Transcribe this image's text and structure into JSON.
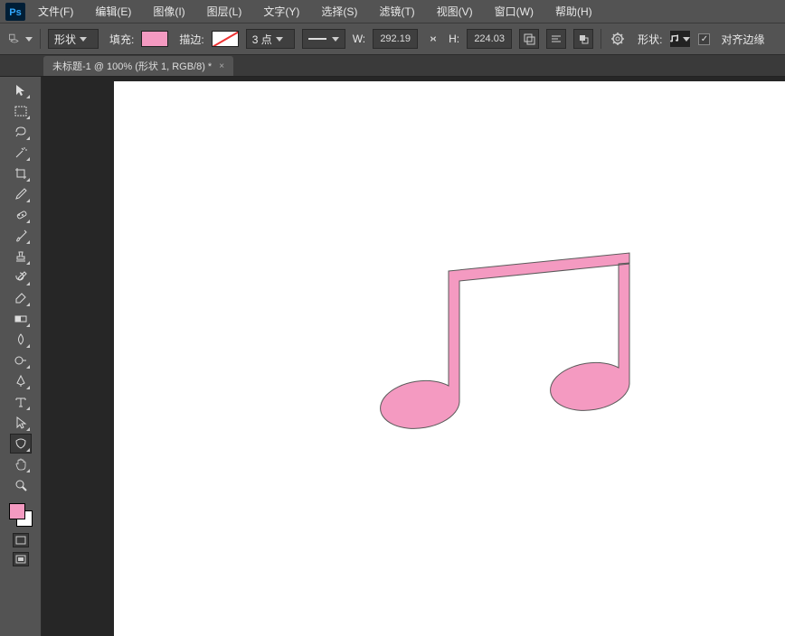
{
  "app": {
    "logo": "Ps"
  },
  "menu": {
    "file": "文件(F)",
    "edit": "编辑(E)",
    "image": "图像(I)",
    "layer": "图层(L)",
    "type": "文字(Y)",
    "select": "选择(S)",
    "filter": "滤镜(T)",
    "view": "视图(V)",
    "window": "窗口(W)",
    "help": "帮助(H)"
  },
  "options": {
    "mode_label": "形状",
    "fill_label": "填充:",
    "stroke_label": "描边:",
    "stroke_width": "3 点",
    "w_label": "W:",
    "w_value": "292.19",
    "h_label": "H:",
    "h_value": "224.03",
    "shape_label": "形状:",
    "align_edges_label": "对齐边缘"
  },
  "tab": {
    "title": "未标题-1 @ 100% (形状 1, RGB/8) *",
    "close": "×"
  },
  "tools": [
    {
      "name": "move-tool"
    },
    {
      "name": "marquee-tool"
    },
    {
      "name": "lasso-tool"
    },
    {
      "name": "wand-tool"
    },
    {
      "name": "crop-tool"
    },
    {
      "name": "eyedropper-tool"
    },
    {
      "name": "heal-tool"
    },
    {
      "name": "brush-tool"
    },
    {
      "name": "stamp-tool"
    },
    {
      "name": "history-brush-tool"
    },
    {
      "name": "eraser-tool"
    },
    {
      "name": "gradient-tool"
    },
    {
      "name": "blur-tool"
    },
    {
      "name": "dodge-tool"
    },
    {
      "name": "pen-tool"
    },
    {
      "name": "type-tool"
    },
    {
      "name": "path-select-tool"
    },
    {
      "name": "custom-shape-tool"
    },
    {
      "name": "hand-tool"
    },
    {
      "name": "zoom-tool"
    }
  ],
  "colors": {
    "fill": "#f49ac1",
    "canvas_bg": "#ffffff"
  }
}
